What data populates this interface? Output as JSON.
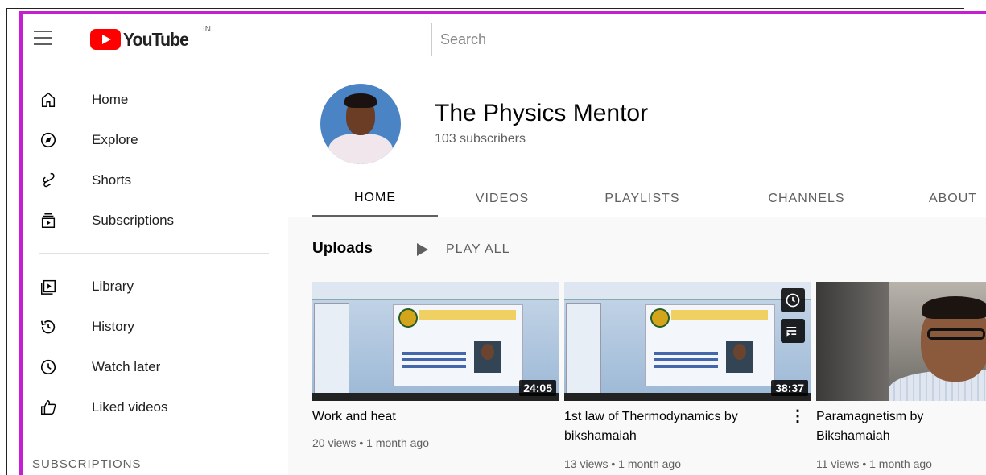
{
  "masthead": {
    "logo_text": "YouTube",
    "country_code": "IN",
    "search_placeholder": "Search"
  },
  "sidebar": {
    "primary": [
      {
        "label": "Home",
        "icon": "home-icon"
      },
      {
        "label": "Explore",
        "icon": "compass-icon"
      },
      {
        "label": "Shorts",
        "icon": "shorts-icon"
      },
      {
        "label": "Subscriptions",
        "icon": "subscriptions-icon"
      }
    ],
    "secondary": [
      {
        "label": "Library",
        "icon": "library-icon"
      },
      {
        "label": "History",
        "icon": "history-icon"
      },
      {
        "label": "Watch later",
        "icon": "clock-icon"
      },
      {
        "label": "Liked videos",
        "icon": "thumbs-up-icon"
      }
    ],
    "section_heading": "SUBSCRIPTIONS"
  },
  "channel": {
    "name": "The Physics Mentor",
    "subscribers": "103 subscribers",
    "tabs": [
      "HOME",
      "VIDEOS",
      "PLAYLISTS",
      "CHANNELS",
      "ABOUT"
    ],
    "active_tab": "HOME"
  },
  "uploads": {
    "title": "Uploads",
    "play_all": "PLAY ALL",
    "videos": [
      {
        "title": "Work and heat",
        "meta": "20 views • 1 month ago",
        "duration": "24:05"
      },
      {
        "title": "1st law of Thermodynamics by bikshamaiah",
        "meta": "13 views • 1 month ago",
        "duration": "38:37"
      },
      {
        "title": "Paramagnetism by Bikshamaiah",
        "meta": "11 views • 1 month ago",
        "duration": ""
      }
    ]
  },
  "colors": {
    "brand_red": "#ff0000",
    "frame_border": "#c41fd0",
    "text_primary": "#030303",
    "text_secondary": "#606060"
  }
}
